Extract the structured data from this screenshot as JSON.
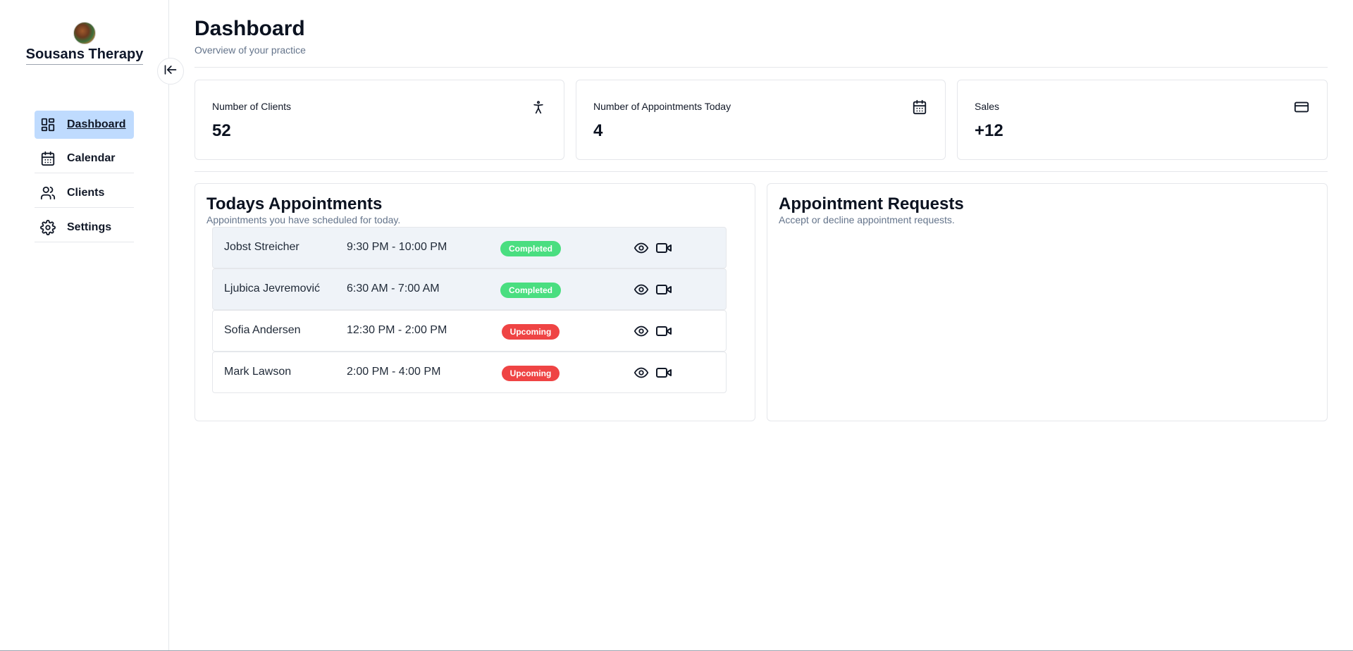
{
  "sidebar": {
    "brand_name": "Sousans Therapy",
    "items": [
      {
        "label": "Dashboard",
        "icon": "dashboard-icon",
        "active": true
      },
      {
        "label": "Calendar",
        "icon": "calendar-icon",
        "active": false
      },
      {
        "label": "Clients",
        "icon": "users-icon",
        "active": false
      },
      {
        "label": "Settings",
        "icon": "gear-icon",
        "active": false
      }
    ]
  },
  "header": {
    "title": "Dashboard",
    "subtitle": "Overview of your practice"
  },
  "stats": [
    {
      "label": "Number of Clients",
      "value": "52",
      "icon": "person-icon"
    },
    {
      "label": "Number of Appointments Today",
      "value": "4",
      "icon": "calendar-icon"
    },
    {
      "label": "Sales",
      "value": "+12",
      "icon": "credit-card-icon"
    }
  ],
  "todays_appointments": {
    "title": "Todays Appointments",
    "subtitle": "Appointments you have scheduled for today.",
    "rows": [
      {
        "name": "Jobst Streicher",
        "time": "9:30 PM - 10:00 PM",
        "status": "Completed"
      },
      {
        "name": "Ljubica Jevremović",
        "time": "6:30 AM - 7:00 AM",
        "status": "Completed"
      },
      {
        "name": "Sofia Andersen",
        "time": "12:30 PM - 2:00 PM",
        "status": "Upcoming"
      },
      {
        "name": "Mark Lawson",
        "time": "2:00 PM - 4:00 PM",
        "status": "Upcoming"
      }
    ]
  },
  "appointment_requests": {
    "title": "Appointment Requests",
    "subtitle": "Accept or decline appointment requests."
  },
  "colors": {
    "active_nav_bg": "#bfdbfe",
    "completed": "#4ade80",
    "upcoming": "#ef4444"
  }
}
